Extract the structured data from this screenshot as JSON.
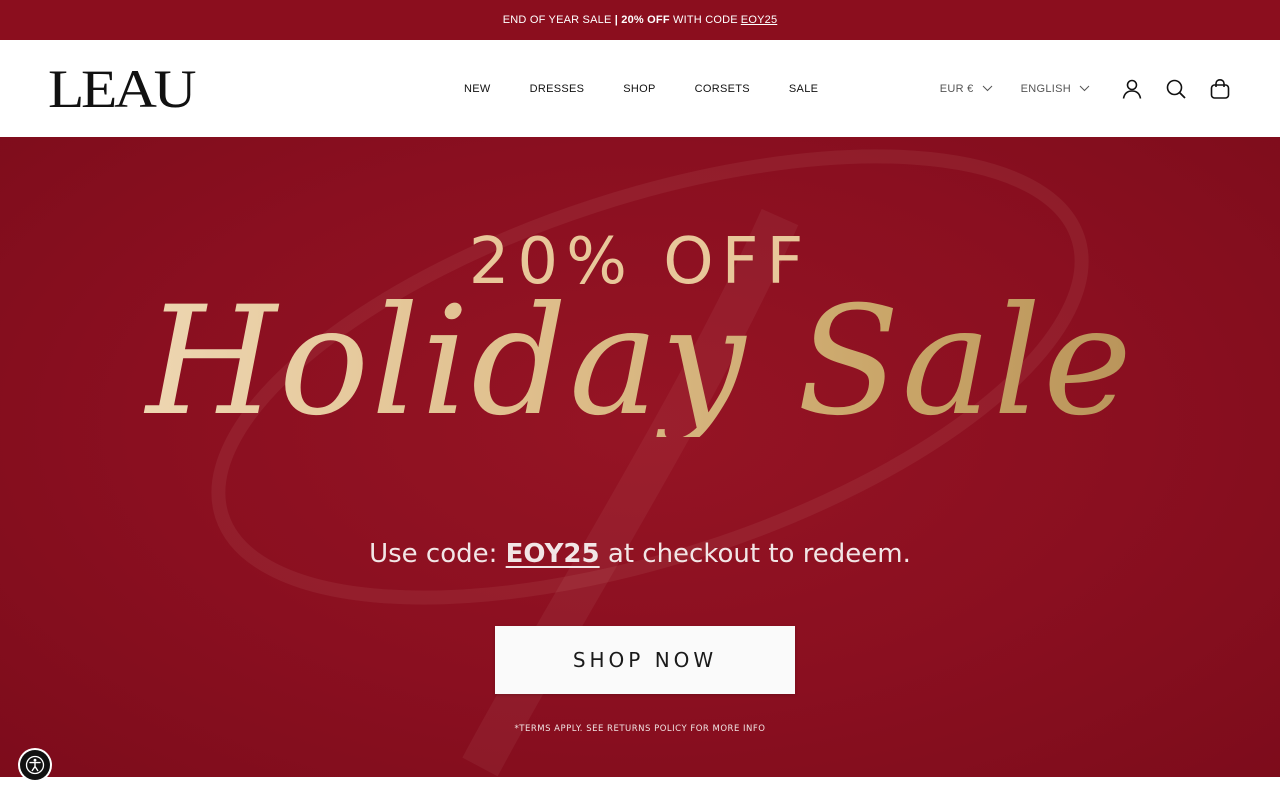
{
  "announcement": {
    "lead": "END OF YEAR SALE",
    "bold": "| 20% OFF",
    "mid": "WITH CODE",
    "code": "EOY25"
  },
  "header": {
    "logo": "LEAU",
    "nav": [
      "NEW",
      "DRESSES",
      "SHOP",
      "CORSETS",
      "SALE"
    ],
    "currency": "EUR €",
    "language": "ENGLISH",
    "icons": [
      "account-icon",
      "search-icon",
      "cart-icon"
    ]
  },
  "hero": {
    "headline": "20% OFF",
    "script_title": "Holiday Sale",
    "code_prefix": "Use code:",
    "code": "EOY25",
    "code_suffix": "at checkout to redeem.",
    "cta": "SHOP NOW",
    "terms": "*TERMS APPLY. SEE RETURNS POLICY FOR MORE INFO"
  },
  "colors": {
    "announcement_bg": "#8b0e1e",
    "hero_bg": "#8a0f20",
    "gold": "#e0c08e"
  },
  "accessibility": {
    "icon": "accessibility-icon"
  }
}
